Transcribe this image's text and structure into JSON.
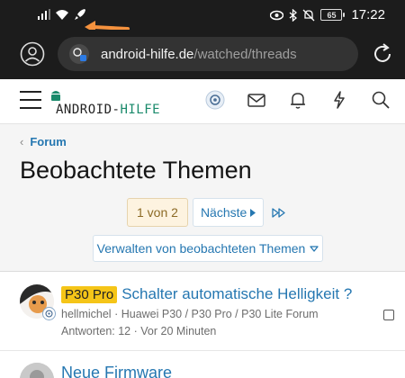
{
  "status_bar": {
    "time": "17:22",
    "battery": "65",
    "icons": [
      "signal-icon",
      "wifi-icon",
      "rocket-icon",
      "eye-icon",
      "bluetooth-icon",
      "mute-icon",
      "battery-icon"
    ]
  },
  "browser": {
    "url_host": "android-hilfe.de",
    "url_path": "/watched/threads"
  },
  "site": {
    "logo_prefix": "ANDROID-",
    "logo_suffix": "HILFE"
  },
  "breadcrumb": {
    "label": "Forum"
  },
  "page": {
    "title": "Beobachtete Themen"
  },
  "pagination": {
    "current": "1 von 2",
    "next_label": "Nächste"
  },
  "manage": {
    "label": "Verwalten von beobachteten Themen"
  },
  "threads": [
    {
      "prefix": "P30 Pro",
      "title": "Schalter automatische Helligkeit ?",
      "author": "hellmichel",
      "forum": "Huawei P30 / P30 Pro / P30 Lite Forum",
      "replies": "Antworten: 12",
      "time": "Vor 20 Minuten"
    },
    {
      "title": "Neue Firmware"
    }
  ],
  "colors": {
    "accent": "#2577b1",
    "prefix_bg": "#f5c518",
    "arrow": "#f5923e"
  }
}
